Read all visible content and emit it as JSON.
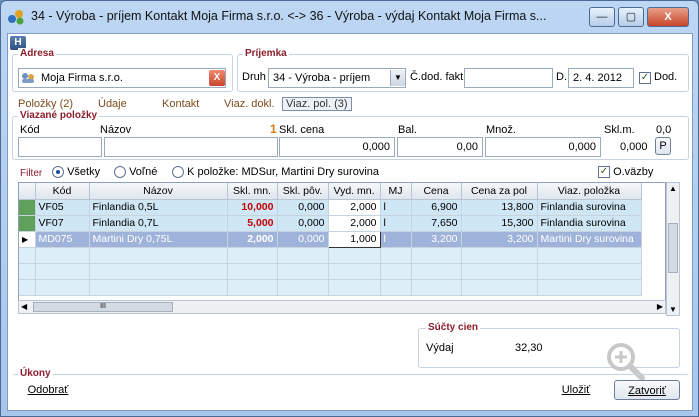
{
  "window": {
    "title": "34 - Výroba - príjem    Kontakt Moja Firma s.r.o.    <-> 36 - Výroba - výdaj    Kontakt Moja Firma s...",
    "min_label": "—",
    "max_label": "▢",
    "close_label": "X"
  },
  "toolbar": {
    "h_label": "H"
  },
  "adresa": {
    "title": "Adresa",
    "value": "Moja Firma s.r.o.",
    "clear_label": "X"
  },
  "prijemka": {
    "title": "Príjemka",
    "druh_label": "Druh",
    "druh_value": "34 - Výroba - príjem",
    "cdod_label": "Č.dod. fakt.",
    "cdod_value": "",
    "d_label": "D.",
    "date_value": "2. 4. 2012",
    "dod_label": "Dod.",
    "dod_checked": "✓"
  },
  "tabs": [
    {
      "label": "Položky (2)"
    },
    {
      "label": "Údaje"
    },
    {
      "label": "Kontakt"
    },
    {
      "label": "Viaz. dokl."
    },
    {
      "label": "Viaz. pol. (3)"
    }
  ],
  "viazane": {
    "title": "Viazané položky",
    "kod_label": "Kód",
    "nazov_label": "Názov",
    "marker": "1",
    "skl_cena_label": "Skl. cena",
    "skl_cena_value": "0,000",
    "bal_label": "Bal.",
    "bal_value": "0,00",
    "mnoz_label": "Množ.",
    "mnoz_value": "0,000",
    "sklm_label": "Skl.m.",
    "sklm_value": "0,000",
    "zero_label": "0,0",
    "p_label": "P"
  },
  "filter": {
    "label": "Filter",
    "options": [
      "Všetky",
      "Voľné",
      "K položke: MDSur, Martini Dry surovina"
    ],
    "selected": 0,
    "ovazby_label": "O.väzby",
    "ovazby_checked": "✓"
  },
  "grid": {
    "columns": [
      "",
      "Kód",
      "Názov",
      "Skl. mn.",
      "Skl. pôv.",
      "Vyd. mn.",
      "MJ",
      "Cena",
      "Cena za pol",
      "Viaz. položka"
    ],
    "rows": [
      {
        "kod": "VF05",
        "nazov": "Finlandia 0,5L",
        "skl_mn": "10,000",
        "skl_pov": "0,000",
        "vyd_mn": "2,000",
        "mj": "l",
        "cena": "6,900",
        "cena_pol": "13,800",
        "viaz": "Finlandia surovina"
      },
      {
        "kod": "VF07",
        "nazov": "Finlandia 0,7L",
        "skl_mn": "5,000",
        "skl_pov": "0,000",
        "vyd_mn": "2,000",
        "mj": "l",
        "cena": "7,650",
        "cena_pol": "15,300",
        "viaz": "Finlandia surovina"
      },
      {
        "kod": "MD075",
        "nazov": "Martini Dry 0,75L",
        "skl_mn": "2,000",
        "skl_pov": "0,000",
        "vyd_mn": "1,000",
        "mj": "l",
        "cena": "3,200",
        "cena_pol": "3,200",
        "viaz": "Martini Dry surovina"
      }
    ],
    "scroll_label": "III"
  },
  "sucty": {
    "title": "Súčty cien",
    "vydaj_label": "Výdaj",
    "vydaj_value": "32,30"
  },
  "ukony": {
    "title": "Úkony",
    "odobrat_label": "Odobrať"
  },
  "actions": {
    "ulozit_label": "Uložiť",
    "zatvorit_label": "Zatvoriť"
  }
}
